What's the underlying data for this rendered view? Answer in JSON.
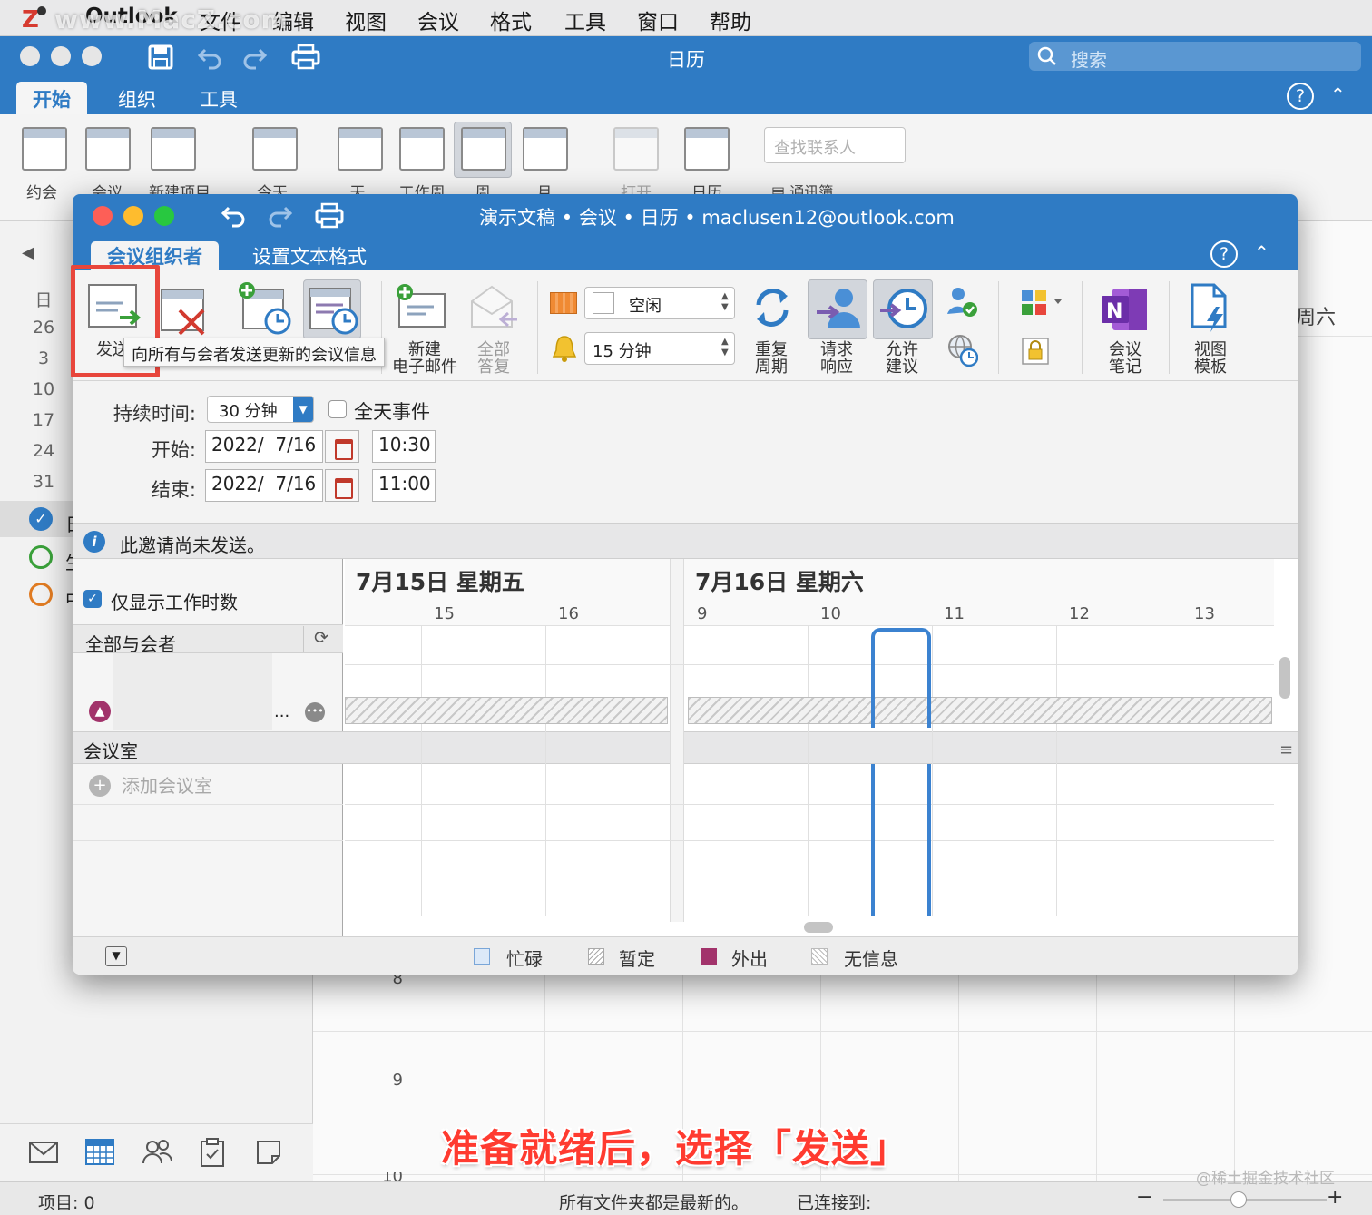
{
  "menubar": {
    "watermark": "www.MacZ.com",
    "items": [
      "Outlook",
      "文件",
      "编辑",
      "视图",
      "会议",
      "格式",
      "工具",
      "窗口",
      "帮助"
    ]
  },
  "main_window": {
    "title": "日历",
    "search_placeholder": "搜索",
    "tabs": [
      "开始",
      "组织",
      "工具"
    ],
    "ribbon": {
      "appointment": "约会",
      "meeting": "会议",
      "new_item": "新建项目",
      "today": "今天",
      "day": "天",
      "work_week": "工作周",
      "week": "周",
      "month": "月",
      "open": "打开",
      "calendar": "日历",
      "find_contact_placeholder": "查找联系人",
      "address_book": "通讯簿"
    },
    "mini_calendar": {
      "header": "日",
      "dates": [
        "26",
        "3",
        "10",
        "17",
        "24",
        "31"
      ]
    },
    "calendar_list": [
      "日",
      "生",
      "中"
    ],
    "week_header_right": "周六",
    "hours": [
      "8",
      "9",
      "10"
    ]
  },
  "dialog": {
    "title": "演示文稿 • 会议 • 日历 • maclusen12@outlook.com",
    "tabs": [
      "会议组织者",
      "设置文本格式"
    ],
    "ribbon": {
      "send": "发送",
      "new_email": "新建\n电子邮件",
      "reply_all": "全部\n答复",
      "show_as": "空闲",
      "reminder": "15 分钟",
      "recurrence": "重复\n周期",
      "request_responses": "请求\n响应",
      "allow_proposals": "允许\n建议",
      "meeting_notes": "会议\n笔记",
      "view_templates": "视图\n模板"
    },
    "tooltip": "向所有与会者发送更新的会议信息",
    "form": {
      "duration_label": "持续时间:",
      "duration_value": "30 分钟",
      "all_day_label": "全天事件",
      "start_label": "开始:",
      "start_date": "2022/  7/16",
      "start_time": "10:30",
      "end_label": "结束:",
      "end_date": "2022/  7/16",
      "end_time": "11:00"
    },
    "info": "此邀请尚未发送。",
    "scheduling": {
      "work_hours_only": "仅显示工作时数",
      "all_attendees": "全部与会者",
      "rooms": "会议室",
      "add_room": "添加会议室",
      "attendee_more": "...",
      "day1": "7月15日 星期五",
      "day1_hours": [
        "15",
        "16"
      ],
      "day2": "7月16日 星期六",
      "day2_hours": [
        "9",
        "10",
        "11",
        "12",
        "13"
      ]
    },
    "legend": [
      "忙碌",
      "暂定",
      "外出",
      "无信息"
    ]
  },
  "statusbar": {
    "items": "项目: 0",
    "sync": "所有文件夹都是最新的。",
    "connected": "已连接到:"
  },
  "annotation": {
    "caption": "准备就绪后，选择「发送」",
    "credit": "@稀土掘金技术社区"
  },
  "colors": {
    "accent": "#2f7bc4",
    "callout": "#e8463c",
    "busy": "#a8c8ee",
    "out_of_office": "#a2336b"
  }
}
